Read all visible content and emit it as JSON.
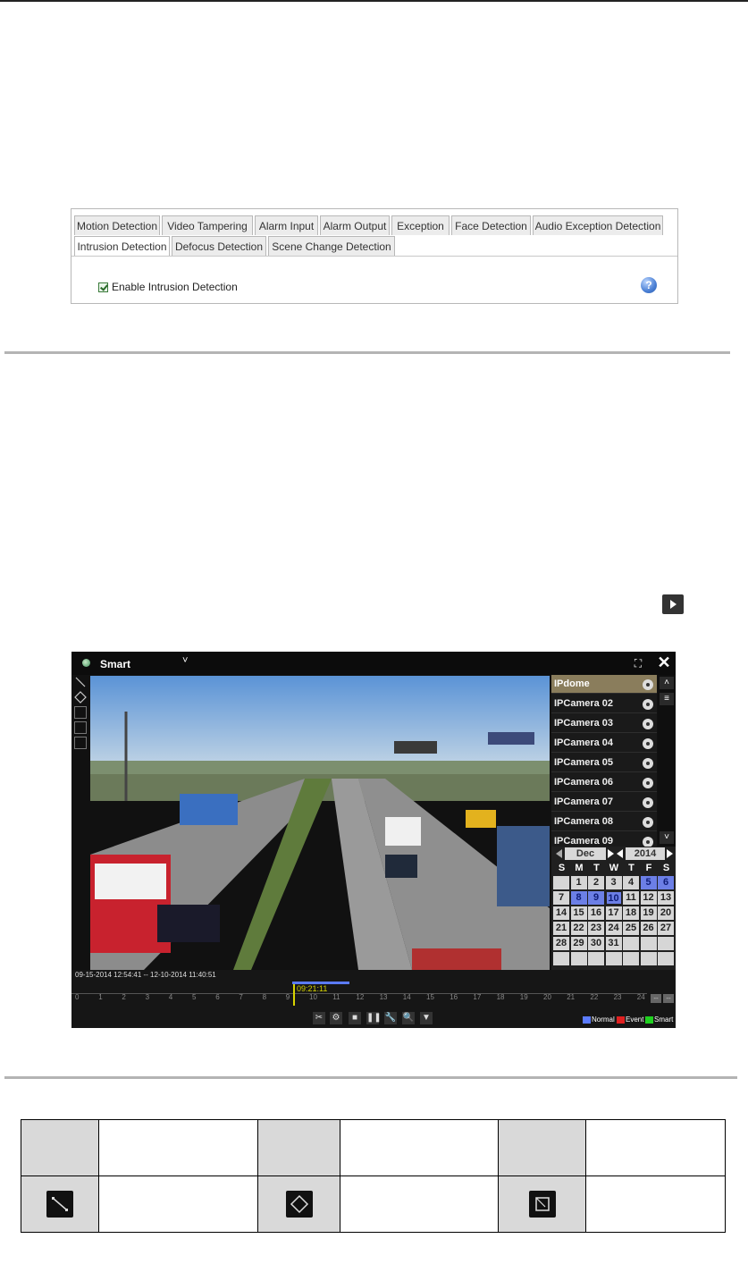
{
  "tabs_row1": [
    "Motion Detection",
    "Video Tampering",
    "Alarm Input",
    "Alarm Output",
    "Exception",
    "Face Detection",
    "Audio Exception Detection"
  ],
  "tabs_row2": [
    "Intrusion Detection",
    "Defocus Detection",
    "Scene Change Detection"
  ],
  "active_tab": "Intrusion Detection",
  "enable_checkbox": {
    "label": "Enable Intrusion Detection",
    "checked": true
  },
  "help_glyph": "?",
  "playback": {
    "mode": "Smart",
    "caret": "˅",
    "full_glyph": "⛶",
    "close_glyph": "✕",
    "cameras": [
      "IPdome",
      "IPCamera 02",
      "IPCamera 03",
      "IPCamera 04",
      "IPCamera 05",
      "IPCamera 06",
      "IPCamera 07",
      "IPCamera 08",
      "IPCamera 09"
    ],
    "selected_camera": "IPdome",
    "calendar": {
      "month": "Dec",
      "year": "2014",
      "days_of_week": [
        "S",
        "M",
        "T",
        "W",
        "T",
        "F",
        "S"
      ],
      "week1": [
        "",
        "1",
        "2",
        "3",
        "4",
        "5",
        "6"
      ],
      "week2": [
        "7",
        "8",
        "9",
        "10",
        "11",
        "12",
        "13"
      ],
      "week3": [
        "14",
        "15",
        "16",
        "17",
        "18",
        "19",
        "20"
      ],
      "week4": [
        "21",
        "22",
        "23",
        "24",
        "25",
        "26",
        "27"
      ],
      "week5": [
        "28",
        "29",
        "30",
        "31",
        "",
        "",
        ""
      ],
      "week6": [
        "",
        "",
        "",
        "",
        "",
        "",
        ""
      ],
      "highlighted_days": [
        "5",
        "6",
        "8",
        "9",
        "10"
      ],
      "selected_day": "10"
    },
    "timeline": {
      "range": "09-15-2014 12:54:41 -- 12-10-2014 11:40:51",
      "current_time": "09:21:11",
      "hours": [
        "0",
        "1",
        "2",
        "3",
        "4",
        "5",
        "6",
        "7",
        "8",
        "9",
        "10",
        "11",
        "12",
        "13",
        "14",
        "15",
        "16",
        "17",
        "18",
        "19",
        "20",
        "21",
        "22",
        "23",
        "24"
      ]
    },
    "legend": [
      {
        "name": "Normal",
        "color": "#5b7bff"
      },
      {
        "name": "Event",
        "color": "#e02020"
      },
      {
        "name": "Smart",
        "color": "#20d020"
      }
    ]
  }
}
